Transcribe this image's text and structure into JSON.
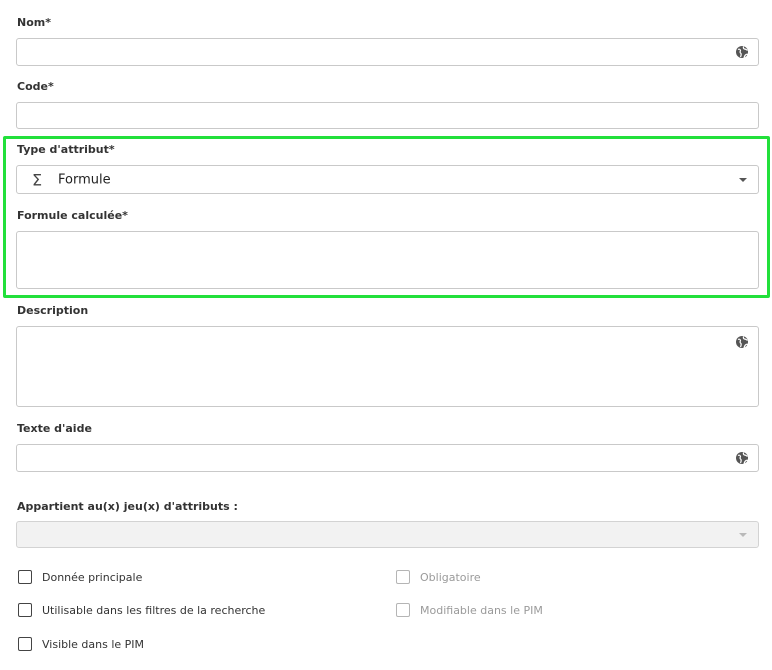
{
  "fields": {
    "nom": {
      "label": "Nom*",
      "value": ""
    },
    "code": {
      "label": "Code*",
      "value": ""
    },
    "type_attribut": {
      "label": "Type d'attribut*",
      "selected": "Formule",
      "icon": "sigma-icon"
    },
    "formule": {
      "label": "Formule calculée*",
      "value": ""
    },
    "description": {
      "label": "Description",
      "value": ""
    },
    "texte_aide": {
      "label": "Texte d'aide",
      "value": ""
    },
    "jeux_attributs": {
      "label": "Appartient au(x) jeu(x) d'attributs :",
      "selected": ""
    }
  },
  "checkboxes": {
    "donnee_principale": {
      "label": "Donnée principale",
      "checked": false,
      "disabled": false
    },
    "utilisable_filtres": {
      "label": "Utilisable dans les filtres de la recherche",
      "checked": false,
      "disabled": false
    },
    "visible_pim": {
      "label": "Visible dans le PIM",
      "checked": false,
      "disabled": false
    },
    "obligatoire": {
      "label": "Obligatoire",
      "checked": false,
      "disabled": true
    },
    "modifiable_pim": {
      "label": "Modifiable dans le PIM",
      "checked": false,
      "disabled": true
    }
  },
  "colors": {
    "highlight": "#22e03b",
    "border": "#c9c9c9",
    "disabled_bg": "#f2f2f2",
    "text": "#333333"
  }
}
